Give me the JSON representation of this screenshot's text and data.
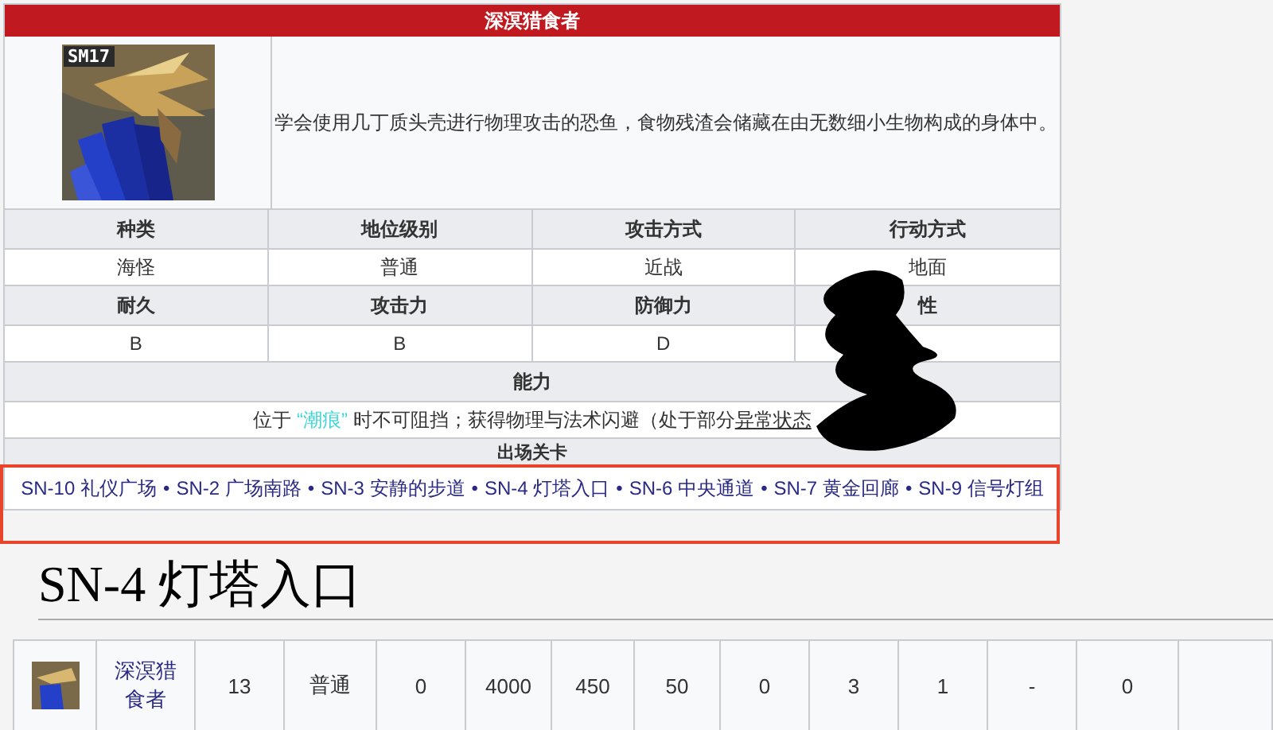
{
  "infobox": {
    "title": "深溟猎食者",
    "portrait_tag": "SM17",
    "description": "学会使用几丁质头壳进行物理攻击的恐鱼，食物残渣会储藏在由无数细小生物构成的身体中。",
    "stat_rows": [
      {
        "kind": "header",
        "cells": [
          "种类",
          "地位级别",
          "攻击方式",
          "行动方式"
        ]
      },
      {
        "kind": "value",
        "cells": [
          "海怪",
          "普通",
          "近战",
          "地面"
        ]
      },
      {
        "kind": "header",
        "cells": [
          "耐久",
          "攻击力",
          "防御力",
          "性"
        ]
      },
      {
        "kind": "value",
        "cells": [
          "B",
          "B",
          "D"
        ]
      }
    ],
    "ability": {
      "heading": "能力",
      "prefix": "位于",
      "highlight": "“潮痕”",
      "middle": "时不可阻挡；获得物理与法术闪避（处于部分",
      "link": "异常状态"
    },
    "stages": {
      "heading": "出场关卡",
      "separator": "•",
      "links": [
        "SN-10 礼仪广场",
        "SN-2 广场南路",
        "SN-3 安静的步道",
        "SN-4 灯塔入口",
        "SN-6 中央通道",
        "SN-7 黄金回廊",
        "SN-9 信号灯组"
      ]
    }
  },
  "stage_heading": "SN-4 灯塔入口",
  "enemy_row": {
    "name": "深溟猎食者",
    "cells": [
      "13",
      "普通",
      "0",
      "4000",
      "450",
      "50",
      "0",
      "3",
      "1",
      "-",
      "0"
    ]
  }
}
